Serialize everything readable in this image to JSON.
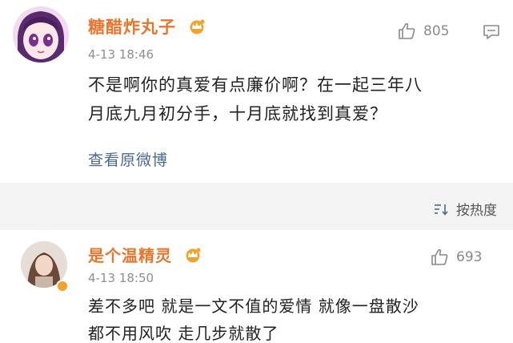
{
  "comments": [
    {
      "username": "糖醋炸丸子",
      "time": "4-13 18:46",
      "likes": "805",
      "text_lines": [
        "不是啊你的真爱有点廉价啊？在一起三年八",
        "月底九月初分手，十月底就找到真爱？"
      ],
      "view_original": "查看原微博"
    },
    {
      "username": "是个温精灵",
      "time": "4-13 18:50",
      "likes": "693",
      "text_lines": [
        "差不多吧 就是一文不值的爱情 就像一盘散沙",
        "都不用风吹 走几步就散了"
      ]
    }
  ],
  "sort": {
    "label": "按热度"
  },
  "colors": {
    "username": "#e8762d",
    "link": "#4a6a8f",
    "separator_bg": "#f4f4f4"
  },
  "icons": [
    "vip-crown-icon",
    "thumbs-up-icon",
    "reply-icon",
    "sort-icon"
  ]
}
